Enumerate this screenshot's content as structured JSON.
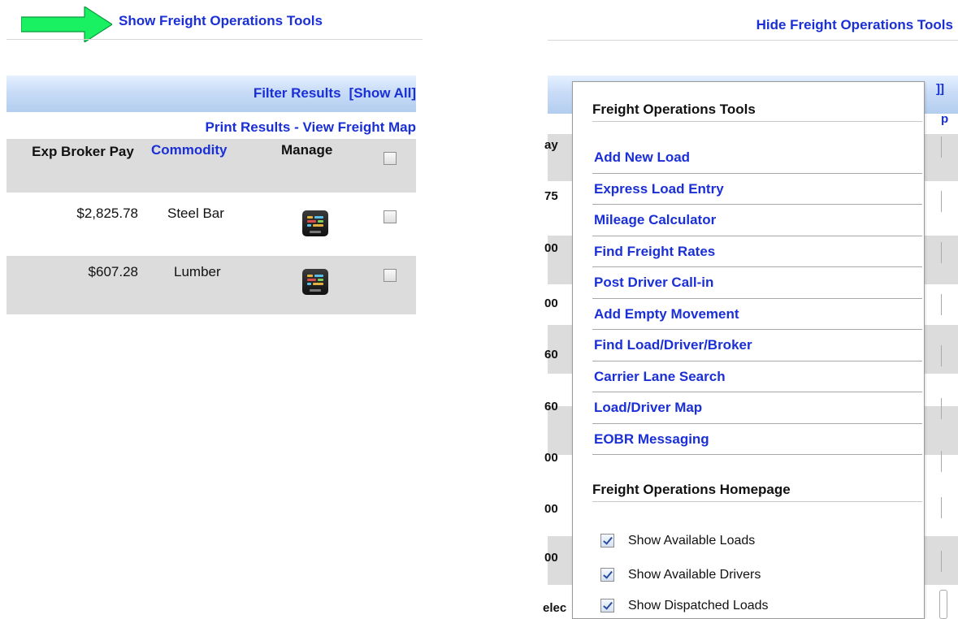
{
  "left": {
    "show_tools_link": "Show Freight Operations Tools",
    "filter_results": "Filter Results",
    "show_all": "[Show All]",
    "print_results": "Print Results",
    "separator": " - ",
    "view_map": "View Freight Map",
    "columns": {
      "exp_broker_pay": "Exp Broker Pay",
      "commodity": "Commodity",
      "manage": "Manage"
    },
    "rows": [
      {
        "pay": "$2,825.78",
        "commodity": "Steel Bar"
      },
      {
        "pay": "$607.28",
        "commodity": "Lumber"
      }
    ]
  },
  "right": {
    "hide_tools_link": "Hide Freight Operations Tools",
    "background_fragments": [
      "]]",
      "p",
      "ay",
      "75",
      "00",
      "00",
      "60",
      "60",
      "00",
      "00",
      "00",
      "elec"
    ],
    "popup": {
      "title": "Freight Operations Tools",
      "items": [
        "Add New Load",
        "Express Load Entry",
        "Mileage Calculator",
        "Find Freight Rates",
        "Post Driver Call-in",
        "Add Empty Movement",
        "Find Load/Driver/Broker",
        "Carrier Lane Search",
        "Load/Driver Map",
        "EOBR Messaging"
      ],
      "homepage_title": "Freight Operations Homepage",
      "checkboxes": [
        {
          "label": "Show Available Loads",
          "checked": true
        },
        {
          "label": "Show Available Drivers",
          "checked": true
        },
        {
          "label": "Show Dispatched Loads",
          "checked": true
        }
      ]
    }
  },
  "colors": {
    "link": "#1a2fd6",
    "arrow_green": "#19f062",
    "header_gradient_top": "#e5f0ff",
    "header_gradient_bottom": "#b3cdef",
    "row_gray": "#dcdcdc"
  }
}
